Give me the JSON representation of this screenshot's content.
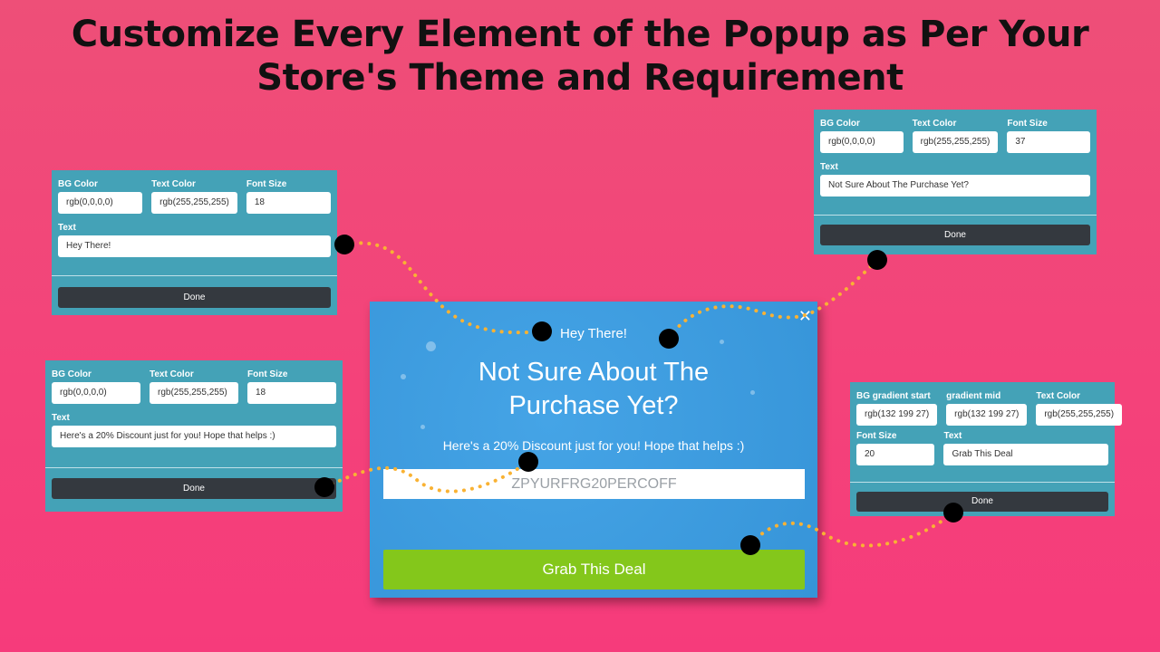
{
  "headline": {
    "line1": "Customize Every Element of the Popup as Per Your",
    "line2": "Store's Theme and Requirement"
  },
  "panels": {
    "greeting": {
      "bg_label": "BG Color",
      "bg": "rgb(0,0,0,0)",
      "color_label": "Text Color",
      "color": "rgb(255,255,255)",
      "size_label": "Font Size",
      "size": "18",
      "text_label": "Text",
      "text": "Hey There!",
      "done": "Done"
    },
    "headline": {
      "bg_label": "BG Color",
      "bg": "rgb(0,0,0,0)",
      "color_label": "Text Color",
      "color": "rgb(255,255,255)",
      "size_label": "Font Size",
      "size": "37",
      "text_label": "Text",
      "text": "Not Sure About The Purchase Yet?",
      "done": "Done"
    },
    "message": {
      "bg_label": "BG Color",
      "bg": "rgb(0,0,0,0)",
      "color_label": "Text Color",
      "color": "rgb(255,255,255)",
      "size_label": "Font Size",
      "size": "18",
      "text_label": "Text",
      "text": "Here's a 20% Discount just for you! Hope that helps :)",
      "done": "Done"
    },
    "button": {
      "start_label": "BG gradient start",
      "start": "rgb(132 199 27)",
      "mid_label": "gradient mid",
      "mid": "rgb(132 199 27)",
      "color_label": "Text Color",
      "color": "rgb(255,255,255)",
      "size_label": "Font Size",
      "size": "20",
      "text_label": "Text",
      "text": "Grab This Deal",
      "done": "Done"
    }
  },
  "popup": {
    "greeting": "Hey There!",
    "headline1": "Not Sure About The",
    "headline2": "Purchase Yet?",
    "message": "Here's a 20% Discount just for you! Hope that helps :)",
    "coupon": "ZPYURFRG20PERCOFF",
    "cta": "Grab This Deal",
    "close_icon": "close-icon"
  },
  "colors": {
    "background": "#f3447a",
    "popup": "#3d9be0",
    "panel": "#44a2b7",
    "cta": "#84c71b",
    "connector": "#f9b233"
  }
}
